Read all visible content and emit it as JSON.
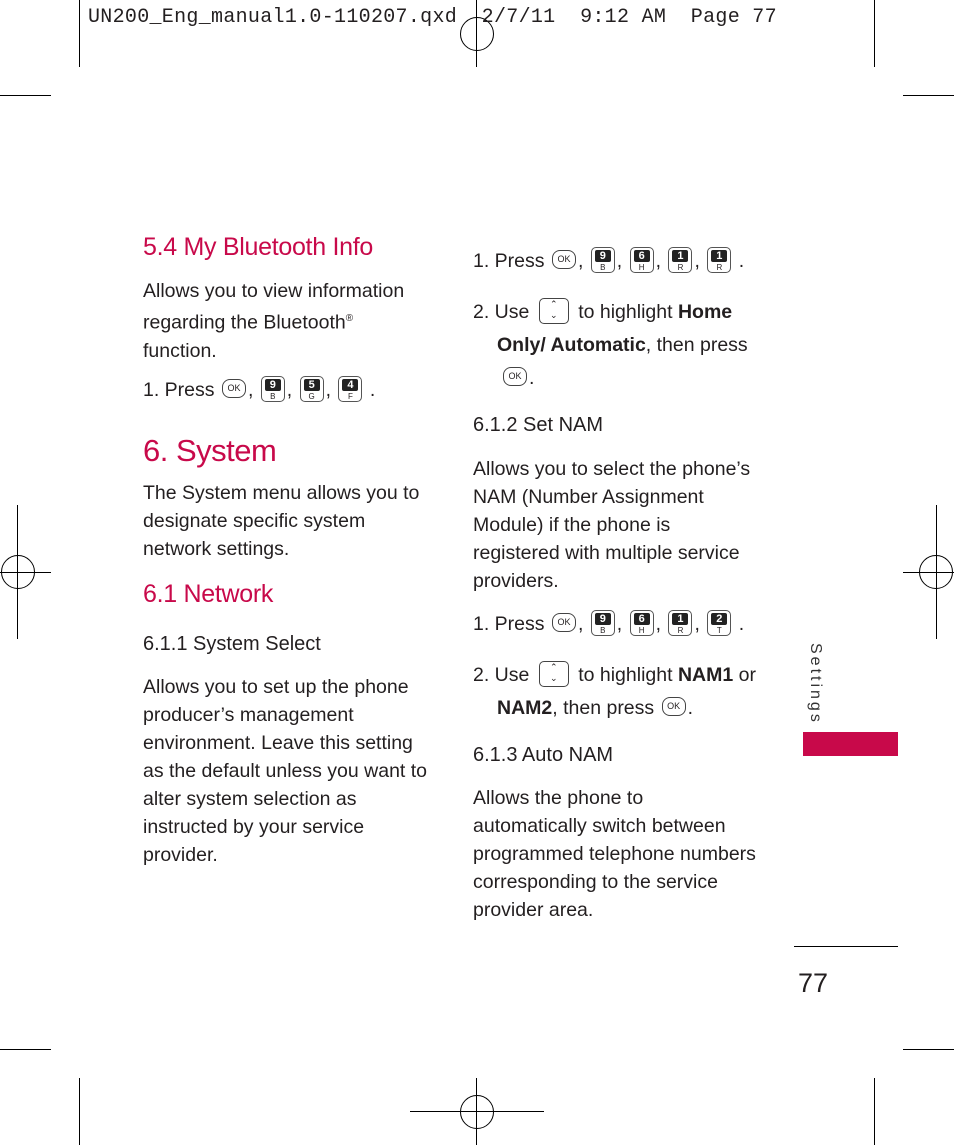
{
  "header": "UN200_Eng_manual1.0-110207.qxd  2/7/11  9:12 AM  Page 77",
  "accent_color": "#c8094a",
  "left": {
    "s54_title": "5.4 My Bluetooth Info",
    "s54_body": [
      "Allows you to view information",
      "regarding the Bluetooth",
      "function."
    ],
    "registered": "®",
    "s54_step1": "1. Press",
    "s54_keys": [
      {
        "type": "ok",
        "label": "OK"
      },
      {
        "n": "9",
        "l": "B"
      },
      {
        "n": "5",
        "l": "G"
      },
      {
        "n": "4",
        "l": "F"
      }
    ],
    "s6_title": "6. System",
    "s6_body": [
      "The System menu allows you to",
      "designate specific system",
      "network settings."
    ],
    "s61_title": "6.1 Network",
    "s611_title": "6.1.1 System Select",
    "s611_body": [
      "Allows you to set up the phone",
      "producer’s management",
      "environment. Leave this setting",
      "as the default unless you want to",
      "alter system selection as",
      "instructed by your service",
      "provider."
    ]
  },
  "right": {
    "step1": "1. Press",
    "keys1": [
      {
        "type": "ok",
        "label": "OK"
      },
      {
        "n": "9",
        "l": "B"
      },
      {
        "n": "6",
        "l": "H"
      },
      {
        "n": "1",
        "l": "R"
      },
      {
        "n": "1",
        "l": "R"
      }
    ],
    "step2_a": "2. Use",
    "step2_b": "to highlight",
    "step2_home": "Home",
    "step2_only": "Only/ Automatic",
    "step2_c": ", then press",
    "s612_title": "6.1.2 Set NAM",
    "s612_body": [
      "Allows you to select the phone’s",
      "NAM (Number Assignment",
      "Module) if the phone is",
      "registered with multiple service",
      "providers."
    ],
    "s612_step1": "1. Press",
    "keys2": [
      {
        "type": "ok",
        "label": "OK"
      },
      {
        "n": "9",
        "l": "B"
      },
      {
        "n": "6",
        "l": "H"
      },
      {
        "n": "1",
        "l": "R"
      },
      {
        "n": "2",
        "l": "T"
      }
    ],
    "s612_step2_a": "2. Use",
    "s612_step2_b": "to highlight",
    "nam1": "NAM1",
    "or": "or",
    "nam2": "NAM2",
    "then_press": ", then press",
    "s613_title": "6.1.3 Auto NAM",
    "s613_body": [
      "Allows the phone to",
      "automatically switch between",
      "programmed telephone numbers",
      "corresponding to the service",
      "provider area."
    ]
  },
  "ok_label": "OK",
  "section_tab": "Settings",
  "page_number": "77"
}
